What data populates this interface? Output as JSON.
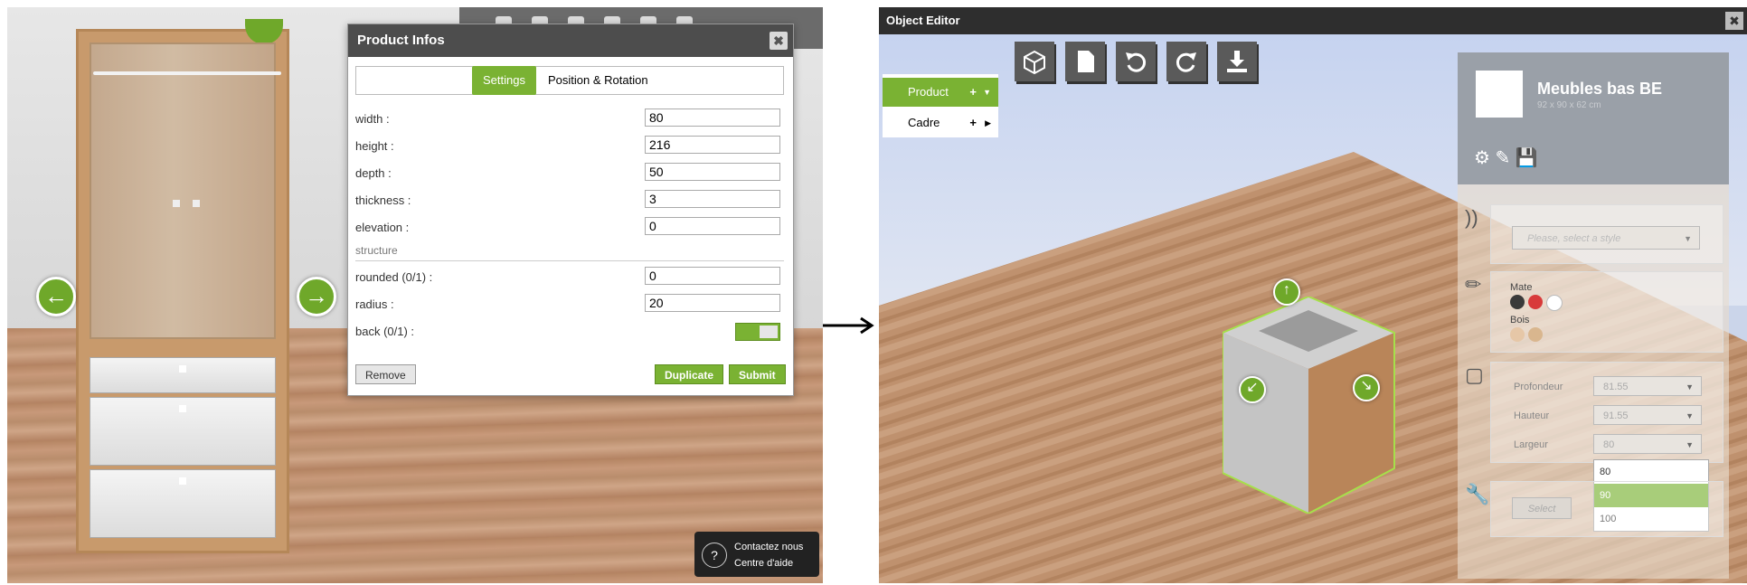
{
  "left": {
    "dialog": {
      "title": "Product Infos",
      "tabs": [
        "Settings",
        "Position & Rotation"
      ],
      "fields": [
        {
          "label": "width :",
          "value": "80"
        },
        {
          "label": "height :",
          "value": "216"
        },
        {
          "label": "depth :",
          "value": "50"
        },
        {
          "label": "thickness :",
          "value": "3"
        },
        {
          "label": "elevation :",
          "value": "0"
        }
      ],
      "section": "structure",
      "structure_fields": [
        {
          "label": "rounded (0/1) :",
          "value": "0"
        },
        {
          "label": "radius :",
          "value": "20"
        }
      ],
      "back_label": "back (0/1) :",
      "back_value": 1,
      "buttons": {
        "remove": "Remove",
        "duplicate": "Duplicate",
        "submit": "Submit"
      }
    },
    "help": {
      "line1": "Contactez nous",
      "line2": "Centre d'aide"
    }
  },
  "right": {
    "title": "Object Editor",
    "tree": [
      {
        "label": "Product",
        "selected": true
      },
      {
        "label": "Cadre",
        "selected": false
      }
    ],
    "product": {
      "name": "Meubles bas BE",
      "dims": "92 x 90 x 62 cm"
    },
    "style_placeholder": "Please, select a style",
    "materials": [
      "Mate",
      "Bois"
    ],
    "dimensions": [
      {
        "label": "Profondeur",
        "value": "81.55"
      },
      {
        "label": "Hauteur",
        "value": "91.55"
      },
      {
        "label": "Largeur",
        "value": "80"
      }
    ],
    "largeur_options": [
      "80",
      "90",
      "100"
    ],
    "largeur_highlight": "90",
    "select_label": "Select"
  },
  "colors": {
    "accent": "#7ab233"
  }
}
